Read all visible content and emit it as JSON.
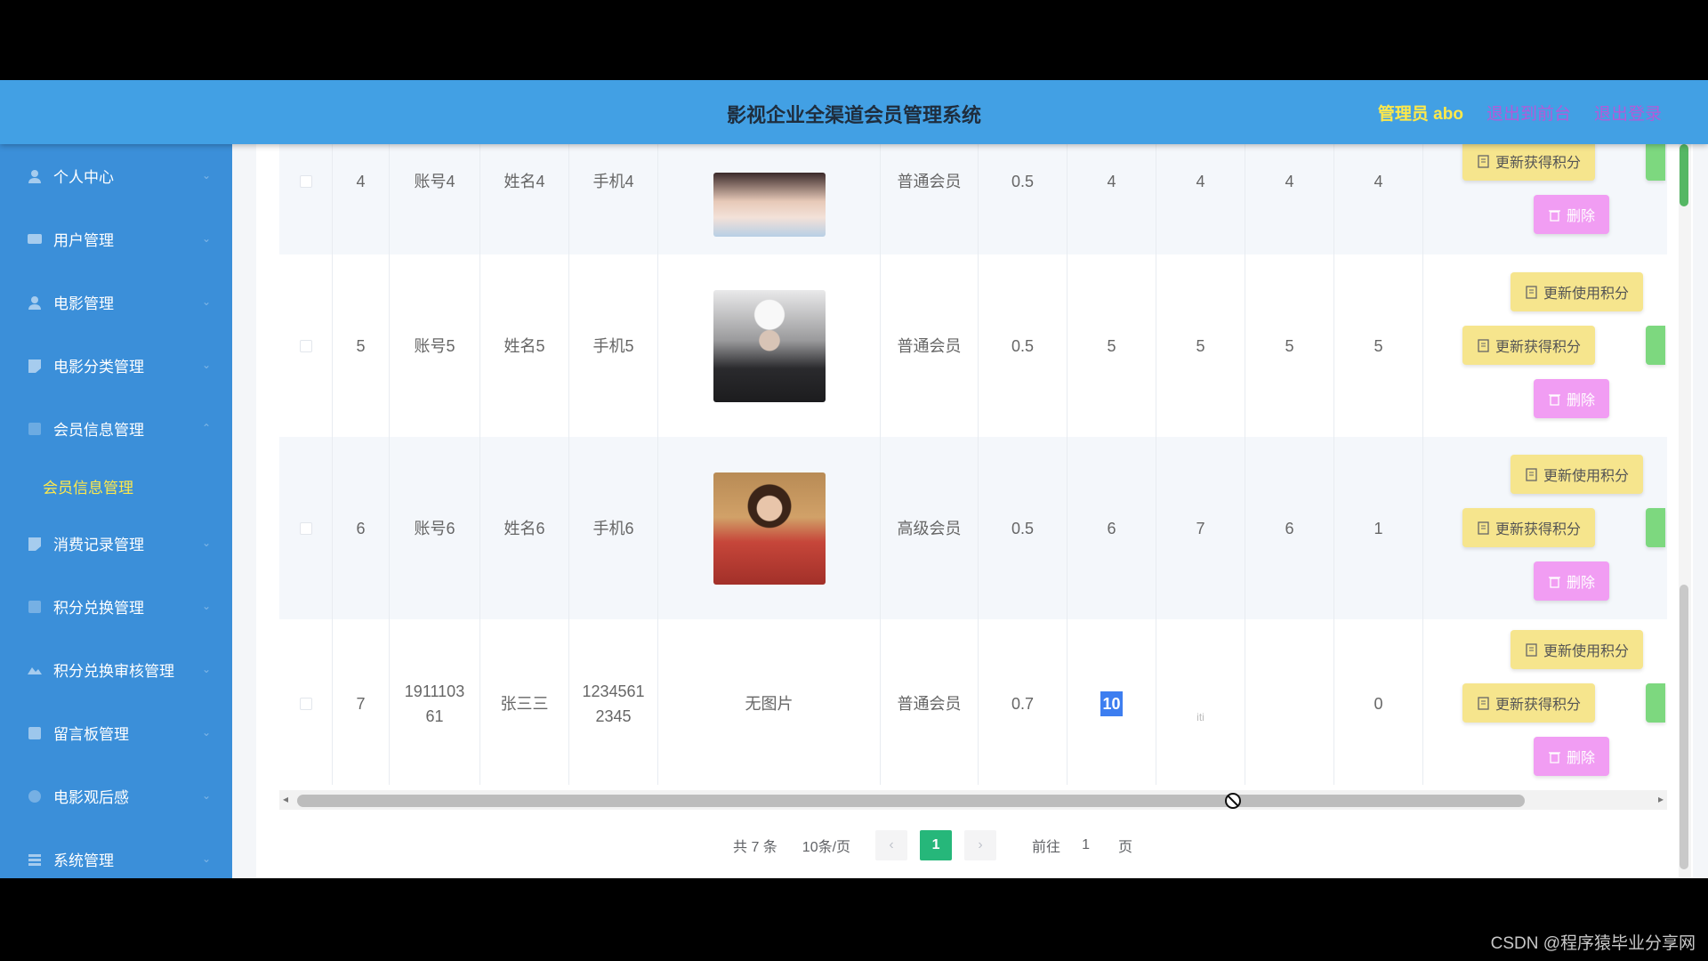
{
  "header": {
    "title": "影视企业全渠道会员管理系统",
    "admin": "管理员 abo",
    "link1": "退出到前台",
    "link2": "退出登录"
  },
  "sidebar": {
    "items": [
      {
        "label": "个人中心",
        "icon": "user-icon"
      },
      {
        "label": "用户管理",
        "icon": "users-icon"
      },
      {
        "label": "电影管理",
        "icon": "film-icon"
      },
      {
        "label": "电影分类管理",
        "icon": "category-icon"
      },
      {
        "label": "会员信息管理",
        "icon": "member-icon"
      }
    ],
    "active_sub": "会员信息管理",
    "items2": [
      {
        "label": "消费记录管理",
        "icon": "receipt-icon"
      },
      {
        "label": "积分兑换管理",
        "icon": "exchange-icon"
      },
      {
        "label": "积分兑换审核管理",
        "icon": "audit-icon"
      },
      {
        "label": "留言板管理",
        "icon": "message-icon"
      },
      {
        "label": "电影观后感",
        "icon": "comment-icon"
      },
      {
        "label": "系统管理",
        "icon": "settings-icon"
      }
    ]
  },
  "table": {
    "rows": [
      {
        "idx": "4",
        "account": "账号4",
        "name": "姓名4",
        "phone": "手机4",
        "photo": "",
        "level": "普通会员",
        "discount": "0.5",
        "c1": "4",
        "c2": "4",
        "c3": "4",
        "c4": "4"
      },
      {
        "idx": "5",
        "account": "账号5",
        "name": "姓名5",
        "phone": "手机5",
        "photo": "",
        "level": "普通会员",
        "discount": "0.5",
        "c1": "5",
        "c2": "5",
        "c3": "5",
        "c4": "5"
      },
      {
        "idx": "6",
        "account": "账号6",
        "name": "姓名6",
        "phone": "手机6",
        "photo": "",
        "level": "高级会员",
        "discount": "0.5",
        "c1": "6",
        "c2": "7",
        "c3": "6",
        "c4": "1"
      },
      {
        "idx": "7",
        "account": "1911103\n61",
        "name": "张三三",
        "phone": "1234561\n2345",
        "photo": "无图片",
        "level": "普通会员",
        "discount": "0.7",
        "c1": "10",
        "c2": "",
        "c3": "",
        "c4": "0"
      }
    ],
    "btn_use_points": "更新使用积分",
    "btn_get_points": "更新获得积分",
    "btn_delete": "删除",
    "stray_text": "iti"
  },
  "pagination": {
    "total": "共 7 条",
    "page_size": "10条/页",
    "prev": "‹",
    "current": "1",
    "next": "›",
    "goto_label": "前往",
    "goto_value": "1",
    "page_unit": "页"
  },
  "watermark": "CSDN @程序猿毕业分享网"
}
